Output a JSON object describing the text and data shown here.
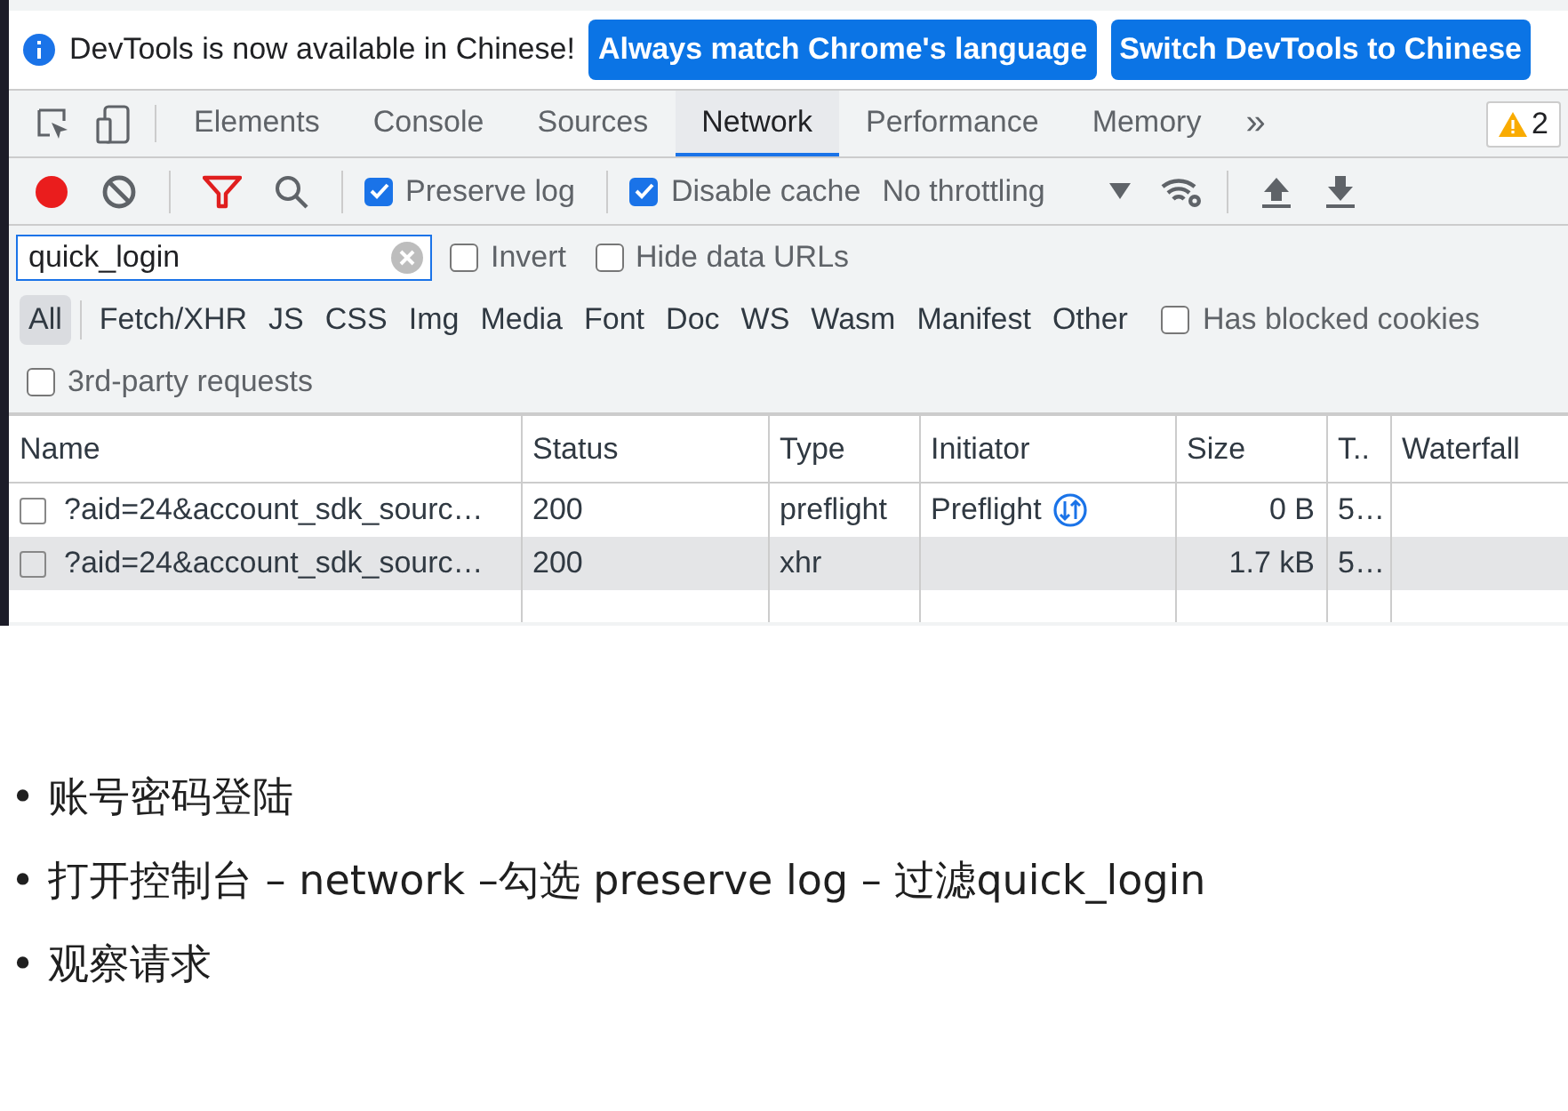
{
  "infobar": {
    "message": "DevTools is now available in Chinese!",
    "buttons": [
      "Always match Chrome's language",
      "Switch DevTools to Chinese"
    ]
  },
  "tabs": [
    {
      "label": "Elements",
      "selected": false
    },
    {
      "label": "Console",
      "selected": false
    },
    {
      "label": "Sources",
      "selected": false
    },
    {
      "label": "Network",
      "selected": true
    },
    {
      "label": "Performance",
      "selected": false
    },
    {
      "label": "Memory",
      "selected": false
    }
  ],
  "more_tabs": "»",
  "warning_count": "2",
  "toolbar": {
    "recording": true,
    "preserve_log": {
      "label": "Preserve log",
      "checked": true
    },
    "disable_cache": {
      "label": "Disable cache",
      "checked": true
    },
    "throttling": "No throttling"
  },
  "filter": {
    "value": "quick_login",
    "options": [
      {
        "label": "Invert",
        "checked": false
      },
      {
        "label": "Hide data URLs",
        "checked": false
      }
    ]
  },
  "types": [
    {
      "label": "All",
      "selected": true
    },
    {
      "label": "Fetch/XHR",
      "selected": false
    },
    {
      "label": "JS",
      "selected": false
    },
    {
      "label": "CSS",
      "selected": false
    },
    {
      "label": "Img",
      "selected": false
    },
    {
      "label": "Media",
      "selected": false
    },
    {
      "label": "Font",
      "selected": false
    },
    {
      "label": "Doc",
      "selected": false
    },
    {
      "label": "WS",
      "selected": false
    },
    {
      "label": "Wasm",
      "selected": false
    },
    {
      "label": "Manifest",
      "selected": false
    },
    {
      "label": "Other",
      "selected": false
    }
  ],
  "blocked_cookies": {
    "label": "Has blocked cookies",
    "checked": false
  },
  "third_party": {
    "label": "3rd-party requests",
    "checked": false
  },
  "table": {
    "columns": [
      "Name",
      "Status",
      "Type",
      "Initiator",
      "Size",
      "T..",
      "Waterfall"
    ],
    "rows": [
      {
        "name": "?aid=24&account_sdk_sourc…",
        "status": "200",
        "type": "preflight",
        "initiator": "Preflight",
        "preflight_icon": true,
        "size": "0 B",
        "time": "5…",
        "selected": false
      },
      {
        "name": "?aid=24&account_sdk_sourc…",
        "status": "200",
        "type": "xhr",
        "preflight_icon": false,
        "size": "1.7 kB",
        "time": "5…",
        "selected": true
      }
    ]
  },
  "bullets": [
    {
      "marker": "•",
      "text": "账号密码登陆"
    },
    {
      "marker": "•",
      "text": "打开控制台 – network –勾选 preserve log – 过滤quick_login"
    },
    {
      "marker": "•",
      "text": "观察请求"
    }
  ]
}
